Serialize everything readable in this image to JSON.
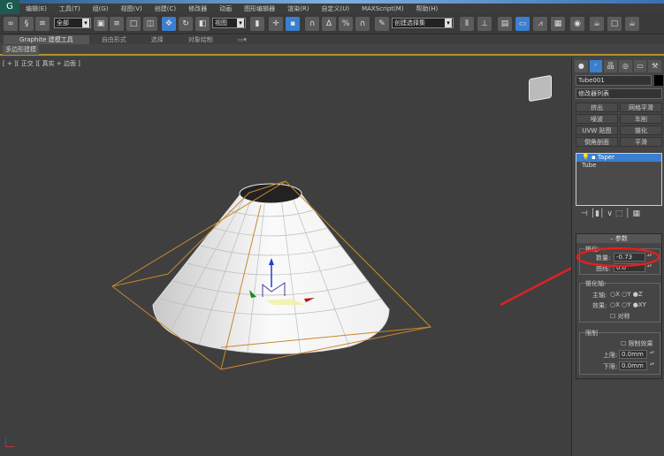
{
  "menu": [
    "编辑(E)",
    "工具(T)",
    "组(G)",
    "视图(V)",
    "创建(C)",
    "修改器",
    "动画",
    "图形编辑器",
    "渲染(R)",
    "自定义(U)",
    "MAXScript(M)",
    "帮助(H)"
  ],
  "toolbar": {
    "selection_filter": "全部",
    "reference_coord": "视图",
    "named_selection": "创建选择集"
  },
  "ribbon": {
    "tabs": [
      "Graphite 建模工具",
      "自由形式",
      "选择",
      "对象绘制"
    ],
    "sub": "多边形建模"
  },
  "viewport": {
    "label": "[ + ][ 正交 ][ 真实 + 边面 ]",
    "gizmo_axis": "z"
  },
  "panel": {
    "object_name": "Tube001",
    "object_color": "#000000",
    "modifier_list": "修改器列表",
    "modifier_buttons": [
      "挤出",
      "网格平滑",
      "噪波",
      "车削",
      "UVW 贴图",
      "锥化",
      "倒角剖面",
      "平滑"
    ],
    "stack": [
      "Taper",
      "Tube"
    ],
    "params_title": "参数",
    "taper_group": "锥化:",
    "amount_label": "数量:",
    "amount_value": "-0.73",
    "curve_label": "曲线:",
    "curve_value": "0.0",
    "axis_group": "锥化轴:",
    "primary_label": "主轴:",
    "primary_options": [
      "X",
      "Y",
      "Z"
    ],
    "primary_selected": "Z",
    "effect_label": "效果:",
    "effect_options": [
      "X",
      "Y",
      "XY"
    ],
    "effect_selected": "XY",
    "symmetry_label": "对称",
    "limits_group": "限制",
    "limit_effect_label": "限制效果",
    "upper_label": "上限:",
    "upper_value": "0.0mm",
    "lower_label": "下限:",
    "lower_value": "0.0mm"
  },
  "colors": {
    "accent": "#3a7fd0",
    "selection_box": "#c8882c",
    "annotation": "#e02020"
  }
}
